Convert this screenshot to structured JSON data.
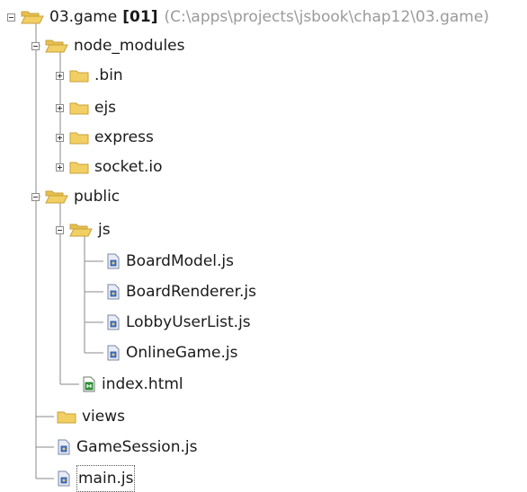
{
  "tree": {
    "root": {
      "label": "03.game",
      "badge": "[01]",
      "path": "(C:\\apps\\projects\\jsbook\\chap12\\03.game)"
    },
    "items": [
      {
        "label": "node_modules",
        "type": "folder-open",
        "expanded": true
      },
      {
        "label": ".bin",
        "type": "folder",
        "expanded": false
      },
      {
        "label": "ejs",
        "type": "folder",
        "expanded": false
      },
      {
        "label": "express",
        "type": "folder",
        "expanded": false
      },
      {
        "label": "socket.io",
        "type": "folder",
        "expanded": false
      },
      {
        "label": "public",
        "type": "folder-open",
        "expanded": true
      },
      {
        "label": "js",
        "type": "folder-open",
        "expanded": true
      },
      {
        "label": "BoardModel.js",
        "type": "js-file"
      },
      {
        "label": "BoardRenderer.js",
        "type": "js-file"
      },
      {
        "label": "LobbyUserList.js",
        "type": "js-file"
      },
      {
        "label": "OnlineGame.js",
        "type": "js-file"
      },
      {
        "label": "index.html",
        "type": "html-file"
      },
      {
        "label": "views",
        "type": "folder"
      },
      {
        "label": "GameSession.js",
        "type": "js-file"
      },
      {
        "label": "main.js",
        "type": "js-file",
        "selected": true
      }
    ]
  },
  "colors": {
    "folder": "#f2cf63",
    "folder_edge": "#c8a23a",
    "tree_line": "#8a8a8a",
    "path_text": "#9a9a9a",
    "js_icon": "#e8ecf6",
    "html_icon": "#2e9b3a"
  }
}
